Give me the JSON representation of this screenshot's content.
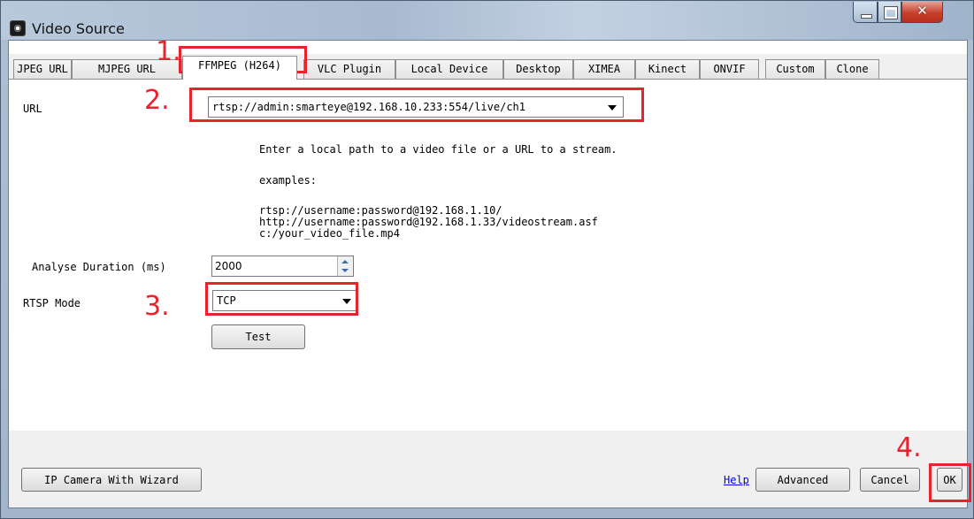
{
  "window": {
    "title": "Video Source"
  },
  "tabs": [
    "JPEG URL",
    "MJPEG URL",
    "FFMPEG (H264)",
    "VLC Plugin",
    "Local Device",
    "Desktop",
    "XIMEA",
    "Kinect",
    "ONVIF",
    "Custom",
    "Clone"
  ],
  "active_tab": "FFMPEG (H264)",
  "form": {
    "url_label": "URL",
    "url_value": "rtsp://admin:smarteye@192.168.10.233:554/live/ch1",
    "help_line": "Enter a local path to a video file or a URL to a stream.",
    "examples_label": "examples:",
    "examples": [
      "rtsp://username:password@192.168.1.10/",
      "http://username:password@192.168.1.33/videostream.asf",
      "c:/your_video_file.mp4"
    ],
    "analyse_label": "Analyse Duration (ms)",
    "analyse_value": "2000",
    "rtsp_label": "RTSP Mode",
    "rtsp_value": "TCP",
    "test_button": "Test"
  },
  "footer": {
    "wizard_button": "IP Camera With Wizard",
    "help_link": "Help",
    "advanced_button": "Advanced",
    "cancel_button": "Cancel",
    "ok_button": "OK"
  },
  "annotations": [
    "1.",
    "2.",
    "3.",
    "4."
  ],
  "colors": {
    "annotation_red": "#e8232d",
    "link_blue": "#0000ff"
  }
}
